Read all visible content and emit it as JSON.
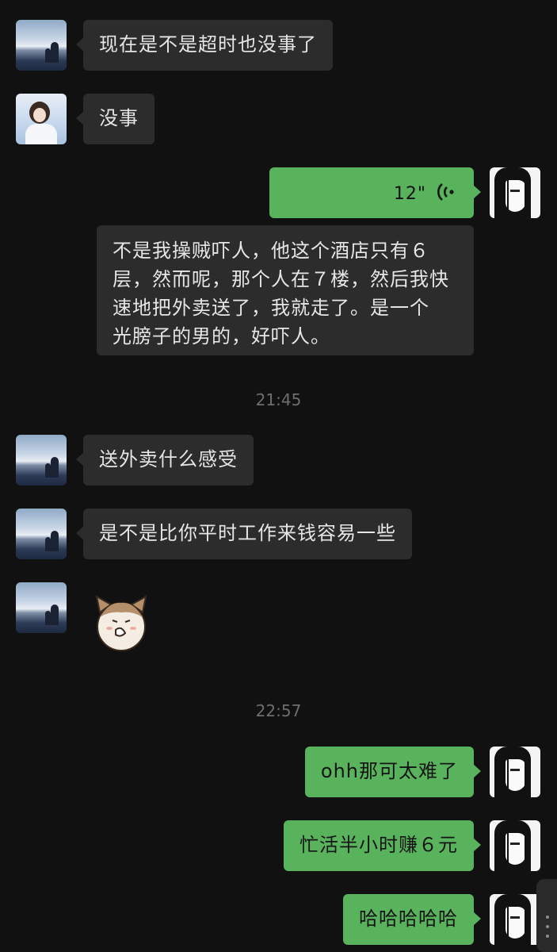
{
  "chat": {
    "messages": [
      {
        "id": "m1",
        "side": "left",
        "avatar": "landscape-avatar",
        "text": "现在是不是超时也没事了"
      },
      {
        "id": "m2",
        "side": "left",
        "avatar": "person-avatar",
        "text": "没事"
      },
      {
        "id": "m3",
        "side": "right",
        "avatar": "manga-avatar",
        "type": "voice",
        "duration": "12\""
      },
      {
        "id": "m4",
        "side": "right",
        "type": "text",
        "lines": [
          "不是我操贼吓人，他这个酒店只有６",
          "层，然而呢，那个人在７楼，然后我快",
          "速地把外卖送了，我就走了。是一个",
          "光膀子的男的，好吓人。"
        ]
      },
      {
        "id": "m5",
        "side": "left",
        "avatar": "landscape-avatar",
        "text": "送外卖什么感受"
      },
      {
        "id": "m6",
        "side": "left",
        "avatar": "landscape-avatar",
        "text": "是不是比你平时工作来钱容易一些"
      },
      {
        "id": "m7",
        "side": "left",
        "avatar": "landscape-avatar",
        "type": "sticker",
        "sticker": "shy-cat-sticker"
      },
      {
        "id": "m8",
        "side": "right",
        "avatar": "manga-avatar",
        "text": "ohh那可太难了"
      },
      {
        "id": "m9",
        "side": "right",
        "avatar": "manga-avatar",
        "text": "忙活半小时赚６元"
      },
      {
        "id": "m10",
        "side": "right",
        "avatar": "manga-avatar",
        "text": "哈哈哈哈哈"
      }
    ],
    "timestamps": [
      "21:45",
      "22:57"
    ]
  },
  "colors": {
    "background": "#111111",
    "incoming_bubble": "#2c2c2c",
    "outgoing_bubble": "#59b25c",
    "timestamp": "#6e6e6e"
  }
}
